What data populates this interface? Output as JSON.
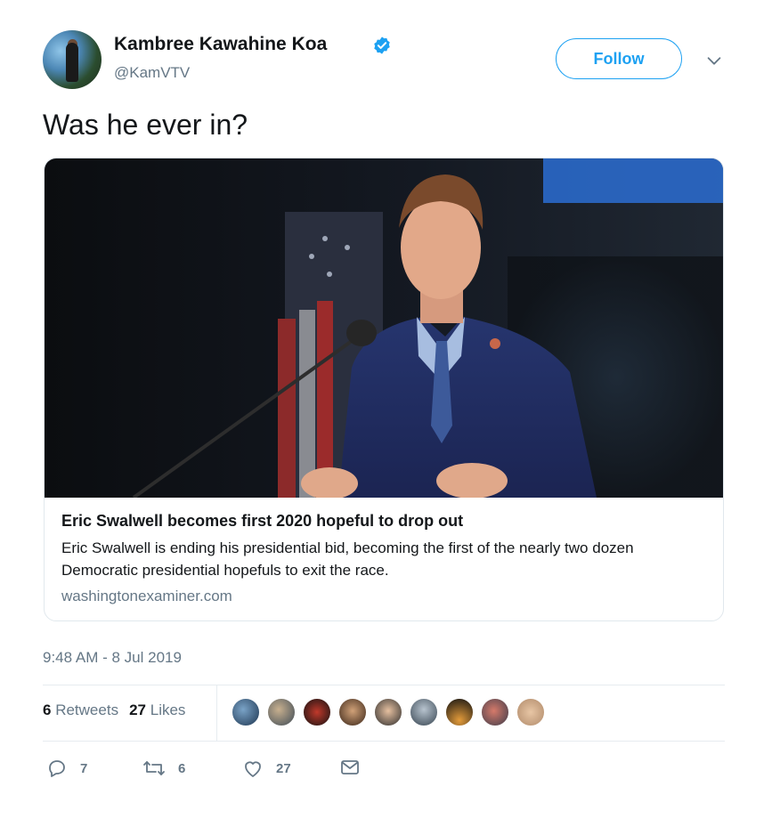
{
  "author": {
    "name": "Kambree Kawahine Koa",
    "handle": "@KamVTV",
    "verified": true
  },
  "follow_label": "Follow",
  "tweet_text": "Was he ever in?",
  "card": {
    "title": "Eric Swalwell becomes first 2020 hopeful to drop out",
    "description": "Eric Swalwell is ending his presidential bid, becoming the first of the nearly two dozen Democratic presidential hopefuls to exit the race.",
    "domain": "washingtonexaminer.com"
  },
  "timestamp": "9:48 AM - 8 Jul 2019",
  "stats": {
    "retweets_count": "6",
    "retweets_label": "Retweets",
    "likes_count": "27",
    "likes_label": "Likes"
  },
  "likers_count_shown": 9,
  "actions": {
    "reply_count": "7",
    "retweet_count": "6",
    "like_count": "27"
  },
  "colors": {
    "accent": "#1da1f2",
    "secondary_text": "#657786",
    "primary_text": "#14171a"
  },
  "icons": [
    "verified-badge-icon",
    "chevron-down-icon",
    "reply-icon",
    "retweet-icon",
    "like-heart-icon",
    "direct-message-icon"
  ]
}
